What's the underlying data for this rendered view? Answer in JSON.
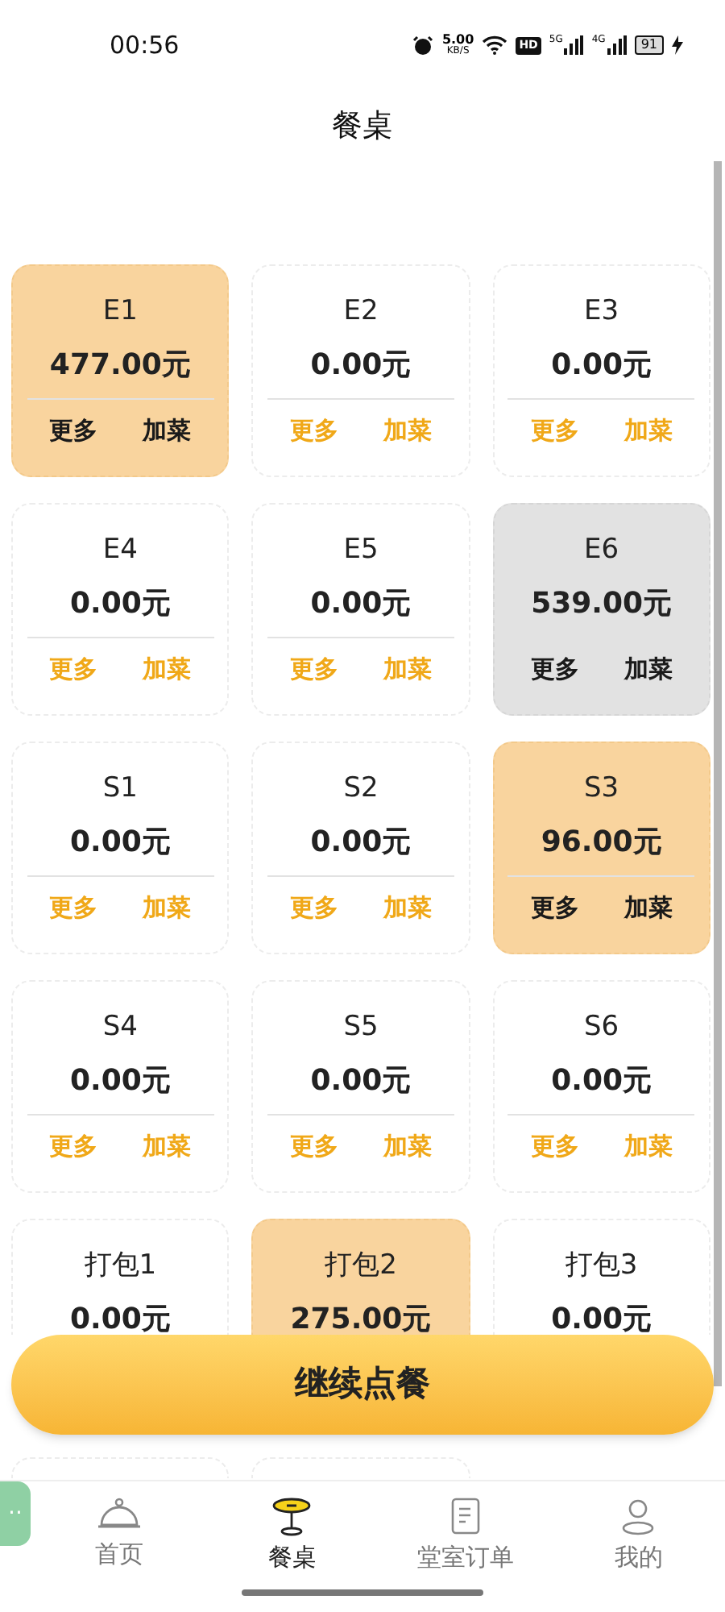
{
  "status_bar": {
    "time": "00:56",
    "speed_value": "5.00",
    "speed_unit": "KB/S",
    "hd": "HD",
    "signal_1": "5G",
    "signal_2": "4G",
    "battery": "91"
  },
  "header": {
    "title": "餐桌"
  },
  "tables": [
    {
      "name": "E1",
      "amount": "477.00元",
      "kind": "occupied",
      "actions": [
        "更多",
        "加菜"
      ]
    },
    {
      "name": "E2",
      "amount": "0.00元",
      "kind": "free",
      "actions": [
        "更多",
        "加菜"
      ]
    },
    {
      "name": "E3",
      "amount": "0.00元",
      "kind": "free",
      "actions": [
        "更多",
        "加菜"
      ]
    },
    {
      "name": "E4",
      "amount": "0.00元",
      "kind": "free",
      "actions": [
        "更多",
        "加菜"
      ]
    },
    {
      "name": "E5",
      "amount": "0.00元",
      "kind": "free",
      "actions": [
        "更多",
        "加菜"
      ]
    },
    {
      "name": "E6",
      "amount": "539.00元",
      "kind": "billed",
      "actions": [
        "更多",
        "加菜"
      ]
    },
    {
      "name": "S1",
      "amount": "0.00元",
      "kind": "free",
      "actions": [
        "更多",
        "加菜"
      ]
    },
    {
      "name": "S2",
      "amount": "0.00元",
      "kind": "free",
      "actions": [
        "更多",
        "加菜"
      ]
    },
    {
      "name": "S3",
      "amount": "96.00元",
      "kind": "occupied",
      "actions": [
        "更多",
        "加菜"
      ]
    },
    {
      "name": "S4",
      "amount": "0.00元",
      "kind": "free",
      "actions": [
        "更多",
        "加菜"
      ]
    },
    {
      "name": "S5",
      "amount": "0.00元",
      "kind": "free",
      "actions": [
        "更多",
        "加菜"
      ]
    },
    {
      "name": "S6",
      "amount": "0.00元",
      "kind": "free",
      "actions": [
        "更多",
        "加菜"
      ]
    },
    {
      "name": "打包1",
      "amount": "0.00元",
      "kind": "free"
    },
    {
      "name": "打包2",
      "amount": "275.00元",
      "kind": "occupied"
    },
    {
      "name": "打包3",
      "amount": "0.00元",
      "kind": "free"
    },
    {
      "kind": "free"
    },
    {
      "kind": "free"
    }
  ],
  "continue_button": {
    "label": "继续点餐"
  },
  "floating_tab": {
    "label": "··"
  },
  "nav": [
    {
      "kind": "home",
      "label": "首页",
      "selected": false
    },
    {
      "kind": "table",
      "label": "餐桌",
      "selected": true
    },
    {
      "kind": "orders",
      "label": "堂室订单",
      "selected": false
    },
    {
      "kind": "profile",
      "label": "我的",
      "selected": false
    }
  ]
}
